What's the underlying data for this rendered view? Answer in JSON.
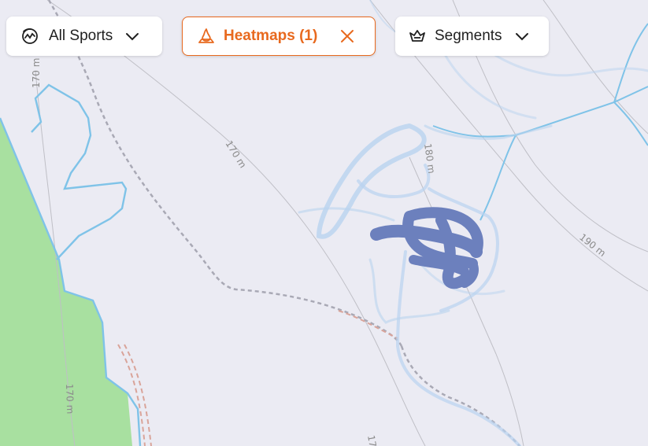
{
  "toolbar": {
    "sports": {
      "label": "All Sports",
      "icon": "all-sports-icon"
    },
    "heatmaps": {
      "label": "Heatmaps (1)",
      "icon": "heatmap-icon",
      "active": true
    },
    "segments": {
      "label": "Segments",
      "icon": "segments-icon"
    }
  },
  "map": {
    "contours": [
      {
        "label": "170 m"
      },
      {
        "label": "170 m"
      },
      {
        "label": "180 m"
      },
      {
        "label": "190 m"
      },
      {
        "label": "170 m"
      },
      {
        "label": "17"
      }
    ]
  },
  "colors": {
    "accent": "#e8691e",
    "map_background": "#ebebf3",
    "park": "#a8e0a0",
    "river": "#7fc3e8",
    "heatmap_light": "#b9d3ef",
    "heatmap_strong": "#6c80bd"
  }
}
